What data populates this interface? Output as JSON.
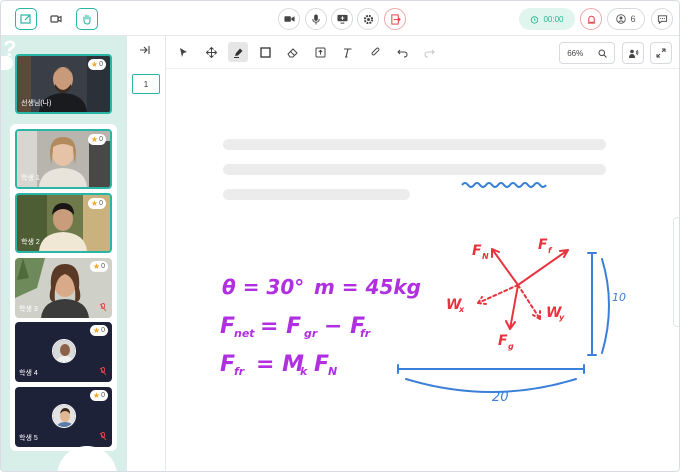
{
  "topbar": {
    "left_tools": [
      {
        "icon": "edit-board-icon",
        "active": true
      },
      {
        "icon": "video-camera-icon",
        "active": false
      },
      {
        "icon": "raise-hand-icon",
        "active": true
      }
    ],
    "center_controls": [
      {
        "icon": "camera-icon"
      },
      {
        "icon": "microphone-icon"
      },
      {
        "icon": "screen-share-icon"
      },
      {
        "icon": "settings-gear-icon"
      },
      {
        "icon": "exit-icon",
        "variant": "red"
      }
    ],
    "timer": "00:00",
    "participants_count": "6",
    "accent_color": "#2bb5a6",
    "exit_color": "#e0474c"
  },
  "video_panel": {
    "teacher": {
      "name": "선생님(나)",
      "stars": "0"
    },
    "students": [
      {
        "name": "학생 1",
        "stars": "0",
        "camera": true,
        "muted": false,
        "selected": true
      },
      {
        "name": "학생 2",
        "stars": "0",
        "camera": true,
        "muted": false,
        "selected": true
      },
      {
        "name": "학생 3",
        "stars": "0",
        "camera": true,
        "muted": true,
        "selected": false
      },
      {
        "name": "학생 4",
        "stars": "0",
        "camera": false,
        "muted": true,
        "selected": false
      },
      {
        "name": "학생 5",
        "stars": "0",
        "camera": false,
        "muted": true,
        "selected": false
      }
    ]
  },
  "pages": {
    "current": "1"
  },
  "whiteboard_toolbar": {
    "tools": [
      "select-arrow-icon",
      "move-icon",
      "highlighter-icon",
      "rectangle-icon",
      "eraser-icon",
      "image-upload-icon",
      "text-tool-icon",
      "attach-icon",
      "undo-icon",
      "redo-icon"
    ],
    "active_tool": "highlighter-icon",
    "zoom": "66%"
  },
  "handwriting": {
    "line1a": "θ = 30°",
    "line1b": "m = 45kg",
    "line2": "F",
    "line2_sub": "net",
    "line2b": "= F",
    "line2_sub2": "gr",
    "line2c": "− F",
    "line2_sub3": "fr",
    "line3": "F",
    "line3_sub": "fr",
    "line3b": "= M",
    "line3_sub2": "k",
    "line3c": "F",
    "line3_sub3": "N",
    "label_fn": "F",
    "label_fn_sub": "N",
    "label_ff": "F",
    "label_ff_sub": "f",
    "label_wx": "W",
    "label_wx_sub": "x",
    "label_wy": "W",
    "label_wy_sub": "y",
    "label_fg": "F",
    "label_fg_sub": "g",
    "dim_height": "10",
    "dim_width": "20",
    "ink_purple": "#b02fe0",
    "ink_red": "#e8333f",
    "ink_blue": "#3a7fd8"
  }
}
